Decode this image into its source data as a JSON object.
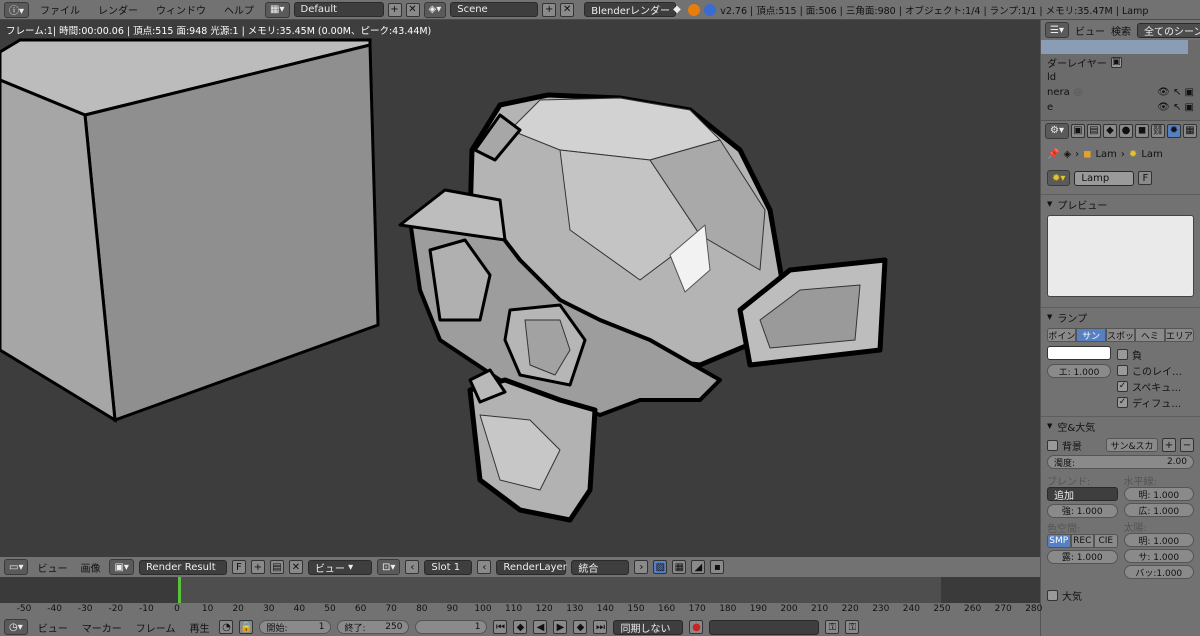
{
  "menus": [
    "ファイル",
    "レンダー",
    "ウィンドウ",
    "ヘルプ"
  ],
  "layout_name": "Default",
  "scene_name": "Scene",
  "render_engine": "Blenderレンダー",
  "stats": "v2.76 | 頂点:515 | 面:506 | 三角面:980 | オブジェクト:1/4 | ランプ:1/1 | メモリ:35.47M | Lamp",
  "viewport_info": "フレーム:1| 時間:00:00.06 | 頂点:515 面:948 光源:1 | メモリ:35.45M (0.00M、ピーク:43.44M)",
  "outliner": {
    "view": "ビュー",
    "search": "検索",
    "all_scenes": "全てのシーン",
    "items": [
      "ダーレイヤー",
      "ld",
      "nera",
      "e"
    ]
  },
  "props": {
    "crumb_lam1": "Lam",
    "crumb_lam2": "Lam",
    "lamp_name": "Lamp",
    "lamp_f": "F",
    "preview_title": "プレビュー",
    "lamp_title": "ランプ",
    "lamp_types": [
      "ポイン",
      "サン",
      "スポッ",
      "ヘミ",
      "エリア"
    ],
    "lamp_types_active": 1,
    "energy": "エ:  1.000",
    "negative": "負",
    "this_layer": "このレイ…",
    "specular": "スペキュ…",
    "diffuse": "ディフュ…",
    "sky_title": "空&大気",
    "sky_label": "背景",
    "sky_select": "サン&スカ",
    "turbidity": "濁度:",
    "turbidity_val": "2.00",
    "blend_label": "ブレンド:",
    "blend_val": "追加",
    "strength": "強:  1.000",
    "horizon_label": "水平線:",
    "brightness": "明:  1.000",
    "spread": "広:  1.000",
    "colorspace_label": "色空間:",
    "colorspaces": [
      "SMP",
      "REC",
      "CIE"
    ],
    "exposure": "露:  1.000",
    "sun_label": "太陽:",
    "sun_bright": "明:  1.000",
    "sun_size": "サ:  1.000",
    "back": "バッ:1.000",
    "atmosphere": "大気"
  },
  "image_header": {
    "view": "ビュー",
    "image": "画像",
    "render_result": "Render Result",
    "f": "F",
    "view2": "ビュー",
    "slot": "Slot 1",
    "layer": "RenderLayer",
    "pass": "統合"
  },
  "timeline": {
    "ticks": [
      "-50",
      "-40",
      "-30",
      "-20",
      "-10",
      "0",
      "10",
      "20",
      "30",
      "40",
      "50",
      "60",
      "70",
      "80",
      "90",
      "100",
      "110",
      "120",
      "130",
      "140",
      "150",
      "160",
      "170",
      "180",
      "190",
      "200",
      "210",
      "220",
      "230",
      "240",
      "250",
      "260",
      "270",
      "280"
    ],
    "menus": [
      "ビュー",
      "マーカー",
      "フレーム",
      "再生"
    ],
    "start": "開始:",
    "start_val": "1",
    "end": "終了:",
    "end_val": "250",
    "current": "1",
    "sync": "同期しない"
  },
  "colors": {
    "accent": "#5680c2",
    "header": "#727272",
    "viewport": "#3d3d3d",
    "frame_marker": "#5ac238"
  }
}
